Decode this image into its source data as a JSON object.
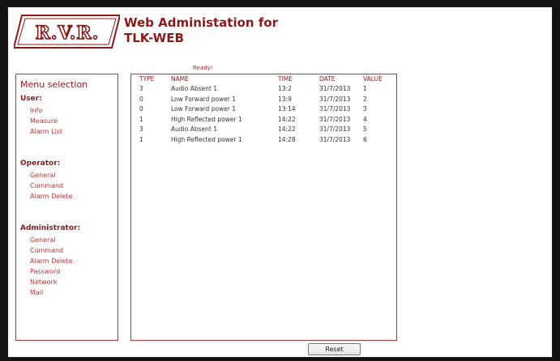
{
  "header": {
    "title_line1": "Web Administation for",
    "title_line2": "TLK-WEB",
    "logo_text": "R.V.R."
  },
  "status_text": "Ready!",
  "menu": {
    "title": "Menu selection",
    "sections": [
      {
        "label": "User:",
        "items": [
          "Info",
          "Measure",
          "Alarm List"
        ]
      },
      {
        "label": "Operator:",
        "items": [
          "General",
          "Command",
          "Alarm Delete"
        ]
      },
      {
        "label": "Administrator:",
        "items": [
          "General",
          "Command",
          "Alarm Delete",
          "Password",
          "Network",
          "Mail"
        ]
      }
    ]
  },
  "alarm_table": {
    "columns": [
      "TYPE",
      "NAME",
      "TIME",
      "DATE",
      "VALUE"
    ],
    "rows": [
      [
        "3",
        "Audio Absent 1",
        "13:2",
        "31/7/2013",
        "1"
      ],
      [
        "0",
        "Low Forward power 1",
        "13:9",
        "31/7/2013",
        "2"
      ],
      [
        "0",
        "Low Forward power 1",
        "13:14",
        "31/7/2013",
        "3"
      ],
      [
        "1",
        "High Reflected power 1",
        "14:22",
        "31/7/2013",
        "4"
      ],
      [
        "3",
        "Audio Absent 1",
        "14:22",
        "31/7/2013",
        "5"
      ],
      [
        "1",
        "High Reflected power 1",
        "14:28",
        "31/7/2013",
        "6"
      ]
    ]
  },
  "buttons": {
    "reset": "Reset"
  },
  "colors": {
    "brand": "#8b1a1a",
    "accent": "#b33333"
  }
}
